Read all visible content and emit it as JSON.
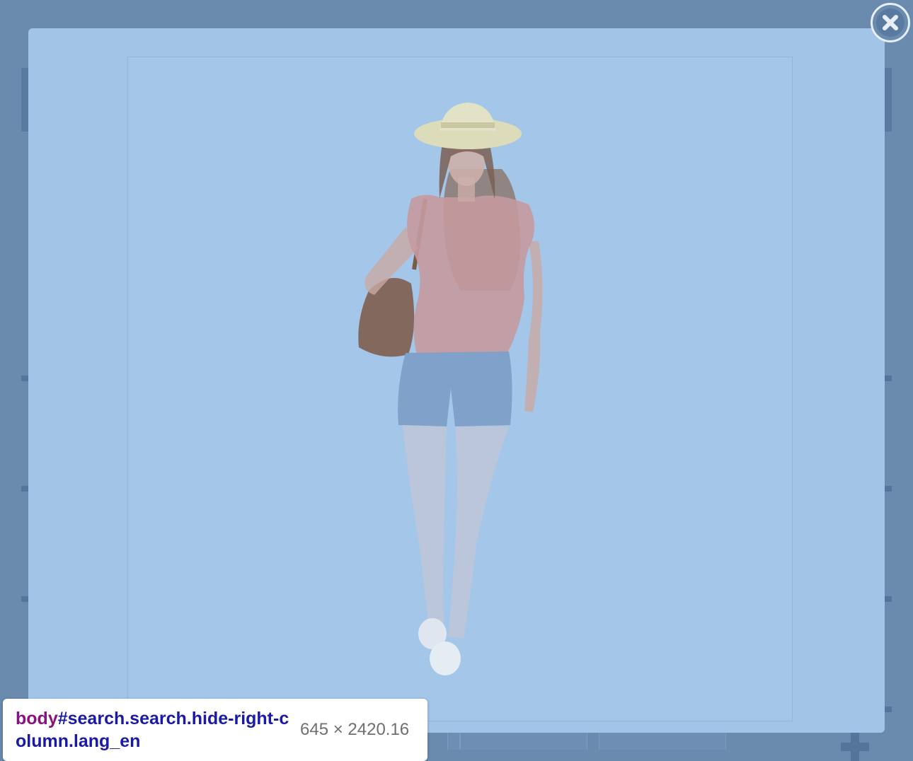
{
  "modal": {
    "image_alt": "Young woman in a straw hat, pink top and denim shorts carrying a brown shoulder bag"
  },
  "close_button": {
    "icon": "close-icon"
  },
  "inspector": {
    "tag": "body",
    "selector_rest": "#search.search.hide-right-column.lang_en",
    "dimensions": "645 × 2420.16"
  },
  "colors": {
    "overlay": "#6a8aae",
    "modal_bg": "#a2c5e7",
    "selector_tag": "#881280",
    "selector_id_class": "#1a1aa6",
    "dims_text": "#707070"
  }
}
